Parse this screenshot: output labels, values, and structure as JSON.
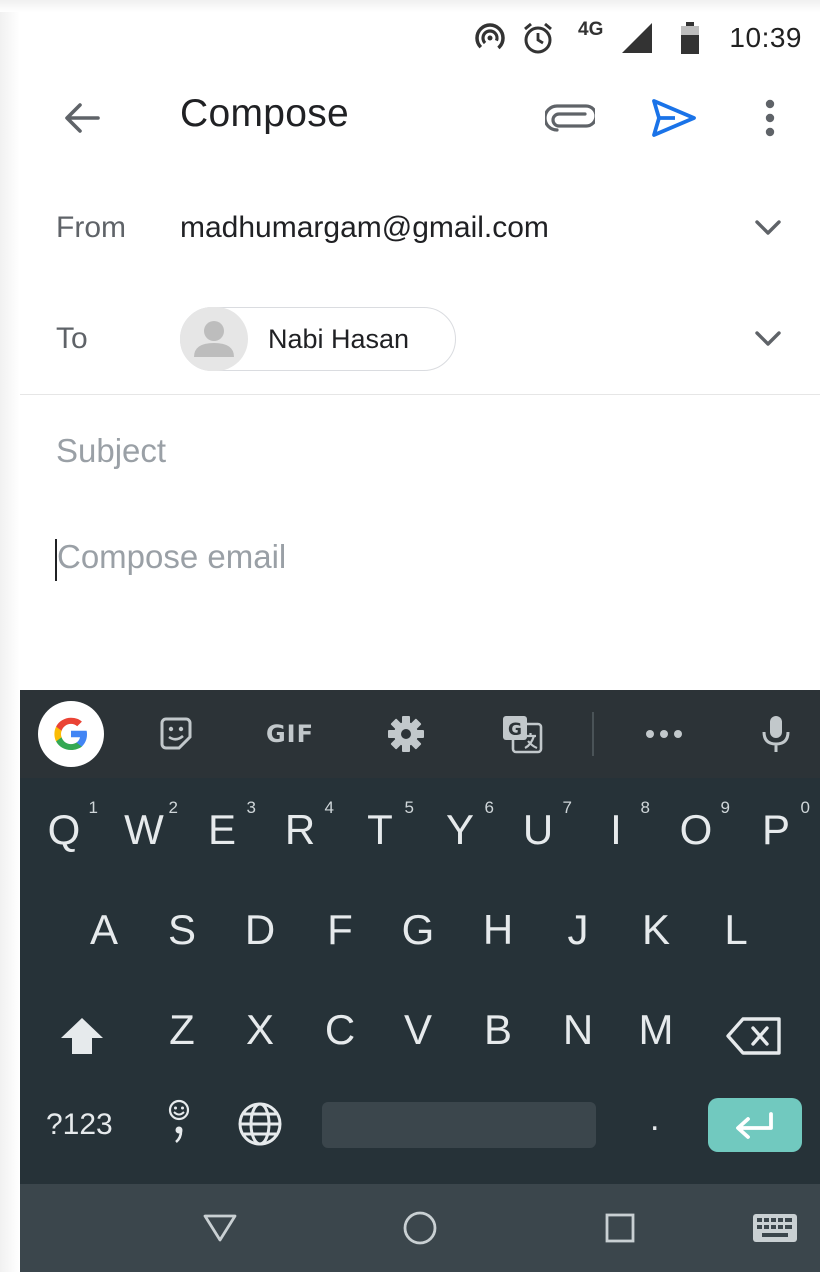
{
  "status_bar": {
    "time": "10:39",
    "network": "4G"
  },
  "app_bar": {
    "title": "Compose"
  },
  "from_row": {
    "label": "From",
    "value": "madhumargam@gmail.com"
  },
  "to_row": {
    "label": "To",
    "chip_name": "Nabi Hasan"
  },
  "subject_row": {
    "placeholder": "Subject"
  },
  "body": {
    "placeholder": "Compose email"
  },
  "keyboard": {
    "toolbar": {
      "gif_label": "GIF"
    },
    "row1": [
      {
        "k": "Q",
        "h": "1"
      },
      {
        "k": "W",
        "h": "2"
      },
      {
        "k": "E",
        "h": "3"
      },
      {
        "k": "R",
        "h": "4"
      },
      {
        "k": "T",
        "h": "5"
      },
      {
        "k": "Y",
        "h": "6"
      },
      {
        "k": "U",
        "h": "7"
      },
      {
        "k": "I",
        "h": "8"
      },
      {
        "k": "O",
        "h": "9"
      },
      {
        "k": "P",
        "h": "0"
      }
    ],
    "row2": [
      "A",
      "S",
      "D",
      "F",
      "G",
      "H",
      "J",
      "K",
      "L"
    ],
    "row3": [
      "Z",
      "X",
      "C",
      "V",
      "B",
      "N",
      "M"
    ],
    "symbols_label": "?123",
    "period_label": "."
  },
  "colors": {
    "send_blue": "#1a73e8",
    "keyboard_bg": "#263238",
    "toolbar_bg": "#2c3337",
    "enter_key": "#71c9bf"
  },
  "icons": {
    "app_bar": [
      "back-arrow-icon",
      "attach-icon",
      "send-icon",
      "more-vert-icon"
    ],
    "status_bar": [
      "hotspot-icon",
      "alarm-icon",
      "signal-icon",
      "battery-icon"
    ],
    "keyboard_toolbar": [
      "google-icon",
      "sticker-icon",
      "gif-icon",
      "settings-icon",
      "translate-icon",
      "more-horiz-icon",
      "mic-icon"
    ],
    "nav_bar": [
      "back-triangle-icon",
      "home-circle-icon",
      "recents-square-icon",
      "keyboard-switch-icon"
    ]
  }
}
